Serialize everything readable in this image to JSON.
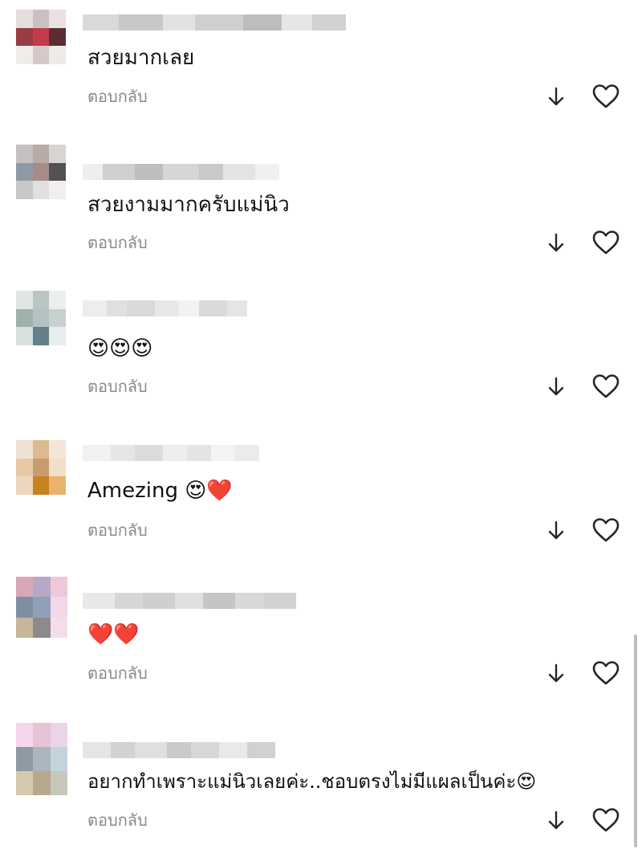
{
  "comments": [
    {
      "text": "สวยมากเลย",
      "reply_label": "ตอบกลับ",
      "avatar_colors": [
        "#e4dedd",
        "#c9c0bf",
        "#e8e1e0",
        "#9a3c45",
        "#c53a4a",
        "#5d2c32",
        "#f1ece9",
        "#d7c9c8",
        "#eeeaea"
      ],
      "username_colors": [
        "#d9d9d9",
        "#c8c8c8",
        "#e2e2e2",
        "#cfcfcf",
        "#bdbdbd",
        "#e6e6e6",
        "#d2d2d2"
      ]
    },
    {
      "text": "สวยงามมากครับแม่นิว",
      "reply_label": "ตอบกลับ",
      "avatar_colors": [
        "#c4c1c0",
        "#b9aaa8",
        "#d8d4d3",
        "#8f9aa6",
        "#a58c86",
        "#555152",
        "#c9c7c8",
        "#e2dfde",
        "#f0eeee"
      ],
      "username_colors": [
        "#eeeeee",
        "#cfcfcf",
        "#bebebe",
        "#d6d6d6",
        "#c9c9c9",
        "#e3e3e3",
        "#f0f0f0"
      ]
    },
    {
      "text": "😍😍😍",
      "reply_label": "ตอบกลับ",
      "avatar_colors": [
        "#e1e6e4",
        "#b7c6c2",
        "#ecefee",
        "#9fb1ad",
        "#b3c1c0",
        "#c7d2d0",
        "#d8e0de",
        "#64808a",
        "#e8ecea"
      ],
      "username_colors": [
        "#ededed",
        "#e0e0e0",
        "#d9d9d9",
        "#e7e7e7",
        "#f2f2f2",
        "#dadada",
        "#e5e5e5"
      ]
    },
    {
      "text": "Amezing 😍❤️",
      "reply_label": "ตอบกลับ",
      "avatar_colors": [
        "#f0e2d2",
        "#ddb98f",
        "#f4e6d7",
        "#e8c8a6",
        "#c99b70",
        "#f2dfc7",
        "#ecd6bd",
        "#c7831f",
        "#e9b36d"
      ],
      "username_colors": [
        "#f1f1f1",
        "#e6e6e6",
        "#dcdcdc",
        "#eeeeee",
        "#e4e4e4",
        "#f3f3f3",
        "#ebebeb"
      ]
    },
    {
      "text": "❤️❤️",
      "reply_label": "ตอบกลับ",
      "avatar_colors": [
        "#d8a7b9",
        "#b9a7c7",
        "#eec7db",
        "#7f8fa3",
        "#90a0b8",
        "#f5d6e8",
        "#c7b69c",
        "#8e8a8a",
        "#f4ddea"
      ],
      "username_colors": [
        "#e8e8e8",
        "#d7d7d7",
        "#cfcfcf",
        "#e0e0e0",
        "#c5c5c5",
        "#d9d9d9",
        "#d2d2d2"
      ]
    },
    {
      "text": "อยากทำเพราะแม่นิวเลยค่ะ..ชอบตรงไม่มีแผลเป็นค่ะ😍",
      "reply_label": "ตอบกลับ",
      "avatar_colors": [
        "#f5d6ea",
        "#e6c2d7",
        "#ead4e7",
        "#8d9aa3",
        "#a9b6c0",
        "#c3d4dc",
        "#d7c9ab",
        "#b8a98e",
        "#c5c7b9"
      ],
      "username_colors": [
        "#e5e5e5",
        "#d2d2d2",
        "#dfdfdf",
        "#cacaca",
        "#d7d7d7",
        "#e9e9e9",
        "#d1d1d1"
      ]
    }
  ],
  "icons": {
    "down": "arrow-down-icon",
    "like": "heart-outline-icon"
  },
  "colors": {
    "text": "#111111",
    "secondary": "#8a8a8a",
    "icon": "#262626"
  }
}
